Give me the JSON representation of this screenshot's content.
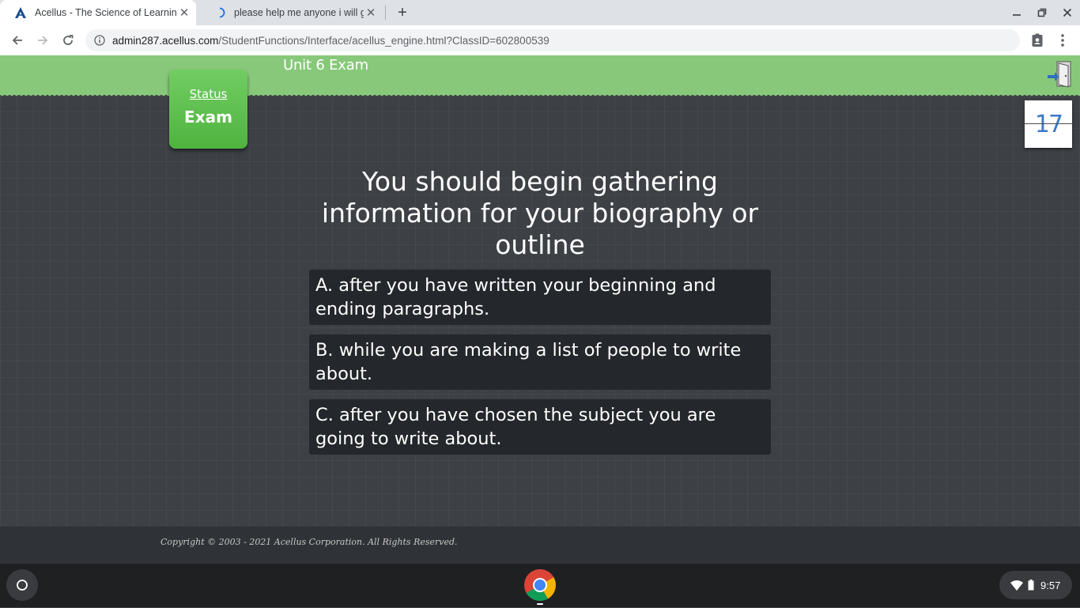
{
  "browser": {
    "tabs": [
      {
        "title": "Acellus - The Science of Learning",
        "active": true
      },
      {
        "title": "please help me anyone i will give",
        "active": false
      }
    ],
    "url_host": "admin287.acellus.com",
    "url_path": "/StudentFunctions/Interface/acellus_engine.html?ClassID=602800539"
  },
  "header": {
    "title": "Unit 6 Exam"
  },
  "status_tile": {
    "label": "Status",
    "value": "Exam"
  },
  "counter": {
    "value": "17"
  },
  "question": {
    "text": "You should begin gathering information for your biography or outline",
    "answers": [
      {
        "text": "A.  after you have written your beginning and ending paragraphs."
      },
      {
        "text": "B.  while you are making a list of people to write about."
      },
      {
        "text": "C.  after you have chosen the subject you are going to write about."
      }
    ]
  },
  "footer": {
    "copyright": "Copyright © 2003 - 2021 Acellus Corporation.  All Rights Reserved."
  },
  "shelf": {
    "time": "9:57"
  },
  "colors": {
    "header_green": "#88c87a",
    "tile_green": "#5bbd4b",
    "answer_bg": "#24272b",
    "counter_blue": "#3a79c7"
  }
}
